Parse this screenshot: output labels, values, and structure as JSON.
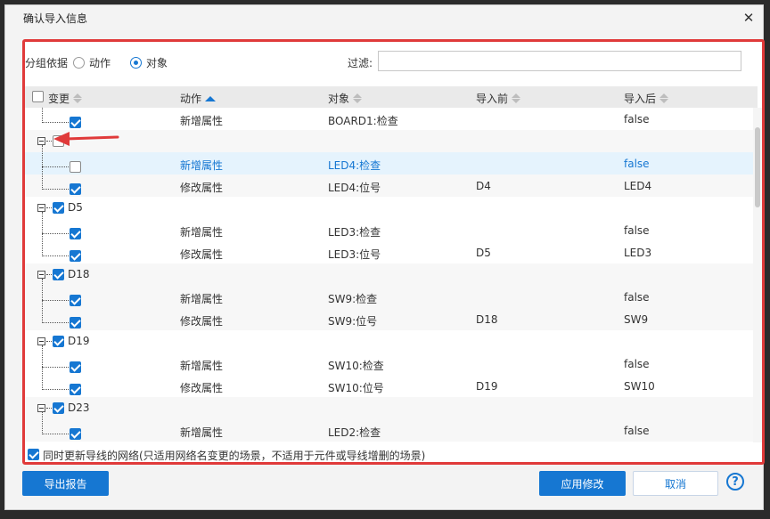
{
  "dialog": {
    "title": "确认导入信息",
    "close_glyph": "✕",
    "close_icon": "close-icon"
  },
  "grouping": {
    "label": "分组依据",
    "options": [
      "动作",
      "对象"
    ],
    "selected": "对象"
  },
  "filter": {
    "label": "过滤:",
    "value": ""
  },
  "table": {
    "columns": [
      "变更",
      "动作",
      "对象",
      "导入前",
      "导入后"
    ],
    "sorted_column": "动作",
    "sort_direction": "asc",
    "groups": [
      {
        "name": "",
        "checked": true,
        "partial": true,
        "rows": [
          {
            "checked": true,
            "action": "新增属性",
            "object": "BOARD1:检查",
            "before": "",
            "after": "false"
          }
        ]
      },
      {
        "name": "",
        "checked": false,
        "rows": [
          {
            "checked": false,
            "action": "新增属性",
            "object": "LED4:检查",
            "before": "",
            "after": "false",
            "highlighted": true
          },
          {
            "checked": true,
            "action": "修改属性",
            "object": "LED4:位号",
            "before": "D4",
            "after": "LED4"
          }
        ]
      },
      {
        "name": "D5",
        "checked": true,
        "rows": [
          {
            "checked": true,
            "action": "新增属性",
            "object": "LED3:检查",
            "before": "",
            "after": "false"
          },
          {
            "checked": true,
            "action": "修改属性",
            "object": "LED3:位号",
            "before": "D5",
            "after": "LED3"
          }
        ]
      },
      {
        "name": "D18",
        "checked": true,
        "rows": [
          {
            "checked": true,
            "action": "新增属性",
            "object": "SW9:检查",
            "before": "",
            "after": "false"
          },
          {
            "checked": true,
            "action": "修改属性",
            "object": "SW9:位号",
            "before": "D18",
            "after": "SW9"
          }
        ]
      },
      {
        "name": "D19",
        "checked": true,
        "rows": [
          {
            "checked": true,
            "action": "新增属性",
            "object": "SW10:检查",
            "before": "",
            "after": "false"
          },
          {
            "checked": true,
            "action": "修改属性",
            "object": "SW10:位号",
            "before": "D19",
            "after": "SW10"
          }
        ]
      },
      {
        "name": "D23",
        "checked": true,
        "rows": [
          {
            "checked": true,
            "action": "新增属性",
            "object": "LED2:检查",
            "before": "",
            "after": "false"
          }
        ]
      }
    ]
  },
  "footer": {
    "sync_nets_checked": true,
    "sync_nets_label": "同时更新导线的网络(只适用网络名变更的场景，不适用于元件或导线增删的场景)"
  },
  "buttons": {
    "export_report": "导出报告",
    "apply": "应用修改",
    "cancel": "取消",
    "help_glyph": "?"
  },
  "colors": {
    "accent": "#1677d2",
    "highlight_frame": "#e03a3a",
    "row_highlight": "#e5f3fd"
  }
}
